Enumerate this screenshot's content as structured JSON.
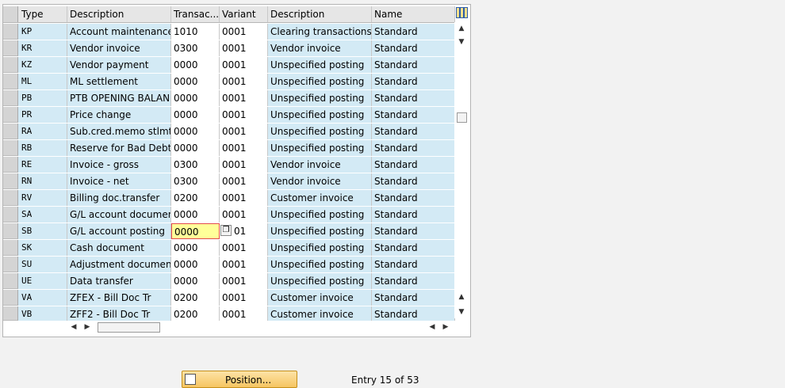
{
  "table": {
    "headers": {
      "type": "Type",
      "description": "Description",
      "transaction": "Transac...",
      "variant": "Variant",
      "var_description": "Description",
      "name": "Name"
    },
    "rows": [
      {
        "type": "KP",
        "description": "Account maintenance",
        "transaction": "1010",
        "variant": "0001",
        "var_description": "Clearing transactions (...",
        "name": "Standard"
      },
      {
        "type": "KR",
        "description": "Vendor invoice",
        "transaction": "0300",
        "variant": "0001",
        "var_description": "Vendor invoice",
        "name": "Standard"
      },
      {
        "type": "KZ",
        "description": "Vendor payment",
        "transaction": "0000",
        "variant": "0001",
        "var_description": "Unspecified posting",
        "name": "Standard"
      },
      {
        "type": "ML",
        "description": "ML settlement",
        "transaction": "0000",
        "variant": "0001",
        "var_description": "Unspecified posting",
        "name": "Standard"
      },
      {
        "type": "PB",
        "description": "PTB OPENING BALAN...",
        "transaction": "0000",
        "variant": "0001",
        "var_description": "Unspecified posting",
        "name": "Standard"
      },
      {
        "type": "PR",
        "description": "Price change",
        "transaction": "0000",
        "variant": "0001",
        "var_description": "Unspecified posting",
        "name": "Standard"
      },
      {
        "type": "RA",
        "description": "Sub.cred.memo stlmt",
        "transaction": "0000",
        "variant": "0001",
        "var_description": "Unspecified posting",
        "name": "Standard"
      },
      {
        "type": "RB",
        "description": "Reserve for Bad Debt",
        "transaction": "0000",
        "variant": "0001",
        "var_description": "Unspecified posting",
        "name": "Standard"
      },
      {
        "type": "RE",
        "description": "Invoice - gross",
        "transaction": "0300",
        "variant": "0001",
        "var_description": "Vendor invoice",
        "name": "Standard"
      },
      {
        "type": "RN",
        "description": "Invoice - net",
        "transaction": "0300",
        "variant": "0001",
        "var_description": "Vendor invoice",
        "name": "Standard"
      },
      {
        "type": "RV",
        "description": "Billing doc.transfer",
        "transaction": "0200",
        "variant": "0001",
        "var_description": "Customer invoice",
        "name": "Standard"
      },
      {
        "type": "SA",
        "description": "G/L account document",
        "transaction": "0000",
        "variant": "0001",
        "var_description": "Unspecified posting",
        "name": "Standard"
      },
      {
        "type": "SB",
        "description": "G/L account posting",
        "transaction": "0000",
        "variant": "01",
        "var_description": "Unspecified posting",
        "name": "Standard"
      },
      {
        "type": "SK",
        "description": "Cash document",
        "transaction": "0000",
        "variant": "0001",
        "var_description": "Unspecified posting",
        "name": "Standard"
      },
      {
        "type": "SU",
        "description": "Adjustment document",
        "transaction": "0000",
        "variant": "0001",
        "var_description": "Unspecified posting",
        "name": "Standard"
      },
      {
        "type": "UE",
        "description": "Data transfer",
        "transaction": "0000",
        "variant": "0001",
        "var_description": "Unspecified posting",
        "name": "Standard"
      },
      {
        "type": "VA",
        "description": "ZFEX  - Bill Doc Tr",
        "transaction": "0200",
        "variant": "0001",
        "var_description": "Customer invoice",
        "name": "Standard"
      },
      {
        "type": "VB",
        "description": "ZFF2  - Bill Doc Tr",
        "transaction": "0200",
        "variant": "0001",
        "var_description": "Customer invoice",
        "name": "Standard"
      }
    ],
    "focused_row": 12
  },
  "footer": {
    "position_button": "Position...",
    "entry_text": "Entry 15 of 53"
  }
}
